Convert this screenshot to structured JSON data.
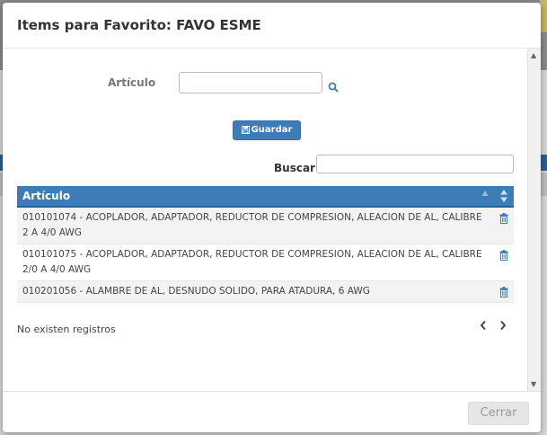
{
  "modal": {
    "title": "Items para Favorito: FAVO ESME"
  },
  "form": {
    "articulo_label": "Artículo",
    "articulo_value": "",
    "guardar_label": "Guardar",
    "buscar_label": "Buscar",
    "buscar_value": ""
  },
  "table": {
    "columns": [
      "Artículo"
    ],
    "rows": [
      "010101074 - ACOPLADOR, ADAPTADOR, REDUCTOR DE COMPRESION, ALEACION DE AL, CALIBRE 2 A 4/0 AWG",
      "010101075 - ACOPLADOR, ADAPTADOR, REDUCTOR DE COMPRESION, ALEACION DE AL, CALIBRE 2/0 A 4/0 AWG",
      "010201056 - ALAMBRE DE AL, DESNUDO SOLIDO, PARA ATADURA, 6 AWG"
    ]
  },
  "pagination": {
    "status": "No existen registros"
  },
  "footer": {
    "cerrar_label": "Cerrar"
  },
  "colors": {
    "primary": "#3e7cb8",
    "header_border": "#2d5f8f"
  }
}
